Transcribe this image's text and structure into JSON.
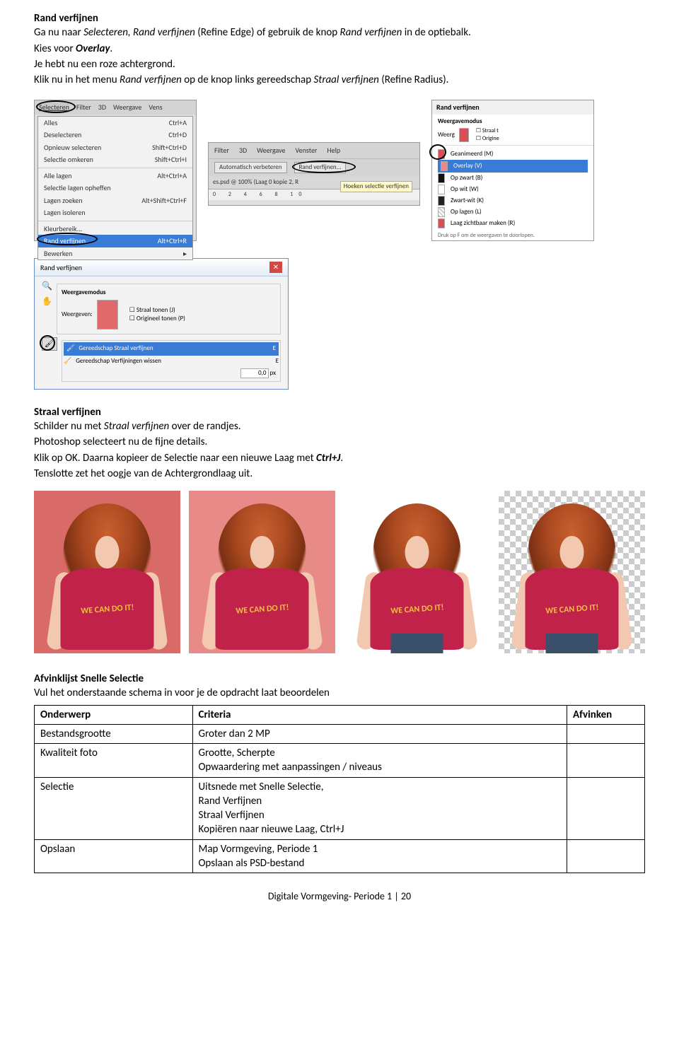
{
  "section1": {
    "heading": "Rand verfijnen",
    "line1a": "Ga nu naar ",
    "line1b": "Selecteren, Rand verfijnen",
    "line1c": " (Refine Edge) of gebruik de knop ",
    "line1d": "Rand verfijnen",
    "line1e": " in de optiebalk.",
    "line2a": "Kies voor ",
    "line2b": "Overlay",
    "line2c": ".",
    "line3": "Je hebt nu een roze achtergrond.",
    "line4a": "Klik nu in het menu ",
    "line4b": "Rand verfijnen",
    "line4c": " op de knop links gereedschap ",
    "line4d": "Straal verfijnen",
    "line4e": " (Refine Radius)."
  },
  "ps_menu": {
    "menubar": [
      "Selecteren",
      "Filter",
      "3D",
      "Weergave",
      "Vens"
    ],
    "items": [
      {
        "label": "Alles",
        "short": "Ctrl+A"
      },
      {
        "label": "Deselecteren",
        "short": "Ctrl+D"
      },
      {
        "label": "Opnieuw selecteren",
        "short": "Shift+Ctrl+D"
      },
      {
        "label": "Selectie omkeren",
        "short": "Shift+Ctrl+I"
      },
      {
        "label": "Alle lagen",
        "short": "Alt+Ctrl+A"
      },
      {
        "label": "Selectie lagen opheffen",
        "short": ""
      },
      {
        "label": "Lagen zoeken",
        "short": "Alt+Shift+Ctrl+F"
      },
      {
        "label": "Lagen isoleren",
        "short": ""
      },
      {
        "label": "Kleurbereik...",
        "short": ""
      },
      {
        "label": "Rand verfijnen...",
        "short": "Alt+Ctrl+R"
      },
      {
        "label": "Bewerken",
        "short": "▸"
      }
    ],
    "highlight_index": 9
  },
  "ps_toolbar": {
    "menubar": [
      "Filter",
      "3D",
      "Weergave",
      "Venster",
      "Help"
    ],
    "btn1": "Automatisch verbeteren",
    "btn2": "Rand verfijnen...",
    "tabname": "es.psd @ 100% (Laag 0 kopie 2, R",
    "tooltip": "Hoeken selectie verfijnen",
    "ruler": "0 2 4 6 8 10"
  },
  "ps_refine_panel": {
    "title": "Rand verfijnen",
    "group": "Weergavemodus",
    "weerg": "Weerg",
    "cb1": "Straal t",
    "cb2": "Origine",
    "items": [
      "Geanimeerd (M)",
      "Overlay (V)",
      "Op zwart (B)",
      "Op wit (W)",
      "Zwart-wit (K)",
      "Op lagen (L)",
      "Laag zichtbaar maken (R)"
    ],
    "hint": "Druk op F om de weergaven te doorlopen.",
    "hl_index": 1
  },
  "ps_dialog": {
    "title": "Rand verfijnen",
    "group1": "Weergavemodus",
    "weerg_label": "Weergeven:",
    "cb1": "Straal tonen (J)",
    "cb2": "Origineel tonen (P)",
    "tool1": "Gereedschap Straal verfijnen",
    "tool1_key": "E",
    "tool2": "Gereedschap Verfijningen wissen",
    "tool2_key": "E",
    "field_val": "0,0",
    "field_unit": "px"
  },
  "section2": {
    "heading": "Straal verfijnen",
    "l1a": "Schilder nu met ",
    "l1b": "Straal verfijnen",
    "l1c": " over de randjes.",
    "l2": "Photoshop selecteert nu de fijne details.",
    "l3a": "Klik op OK. Daarna kopieer de Selectie naar een nieuwe Laag met ",
    "l3b": "Ctrl+J",
    "l3c": ".",
    "l4": "Tenslotte zet het oogje van de Achtergrondlaag uit."
  },
  "shirt_text": "WE CAN DO IT!",
  "section3": {
    "heading": "Afvinklijst Snelle Selectie",
    "intro": "Vul het onderstaande schema in voor je de opdracht laat beoordelen"
  },
  "table": {
    "headers": [
      "Onderwerp",
      "Criteria",
      "Afvinken"
    ],
    "rows": [
      {
        "c1": "Bestandsgrootte",
        "c2": [
          "Groter dan 2 MP"
        ]
      },
      {
        "c1": "Kwaliteit foto",
        "c2": [
          "Grootte, Scherpte",
          "Opwaardering met aanpassingen / niveaus"
        ]
      },
      {
        "c1": "Selectie",
        "c2": [
          "Uitsnede met Snelle Selectie,",
          "Rand Verfijnen",
          "Straal Verfijnen",
          "Kopiëren naar nieuwe Laag, Ctrl+J"
        ]
      },
      {
        "c1": "Opslaan",
        "c2": [
          "Map Vormgeving, Periode 1",
          "Opslaan als PSD-bestand"
        ]
      }
    ]
  },
  "footer": "Digitale Vormgeving- Periode 1 | 20"
}
